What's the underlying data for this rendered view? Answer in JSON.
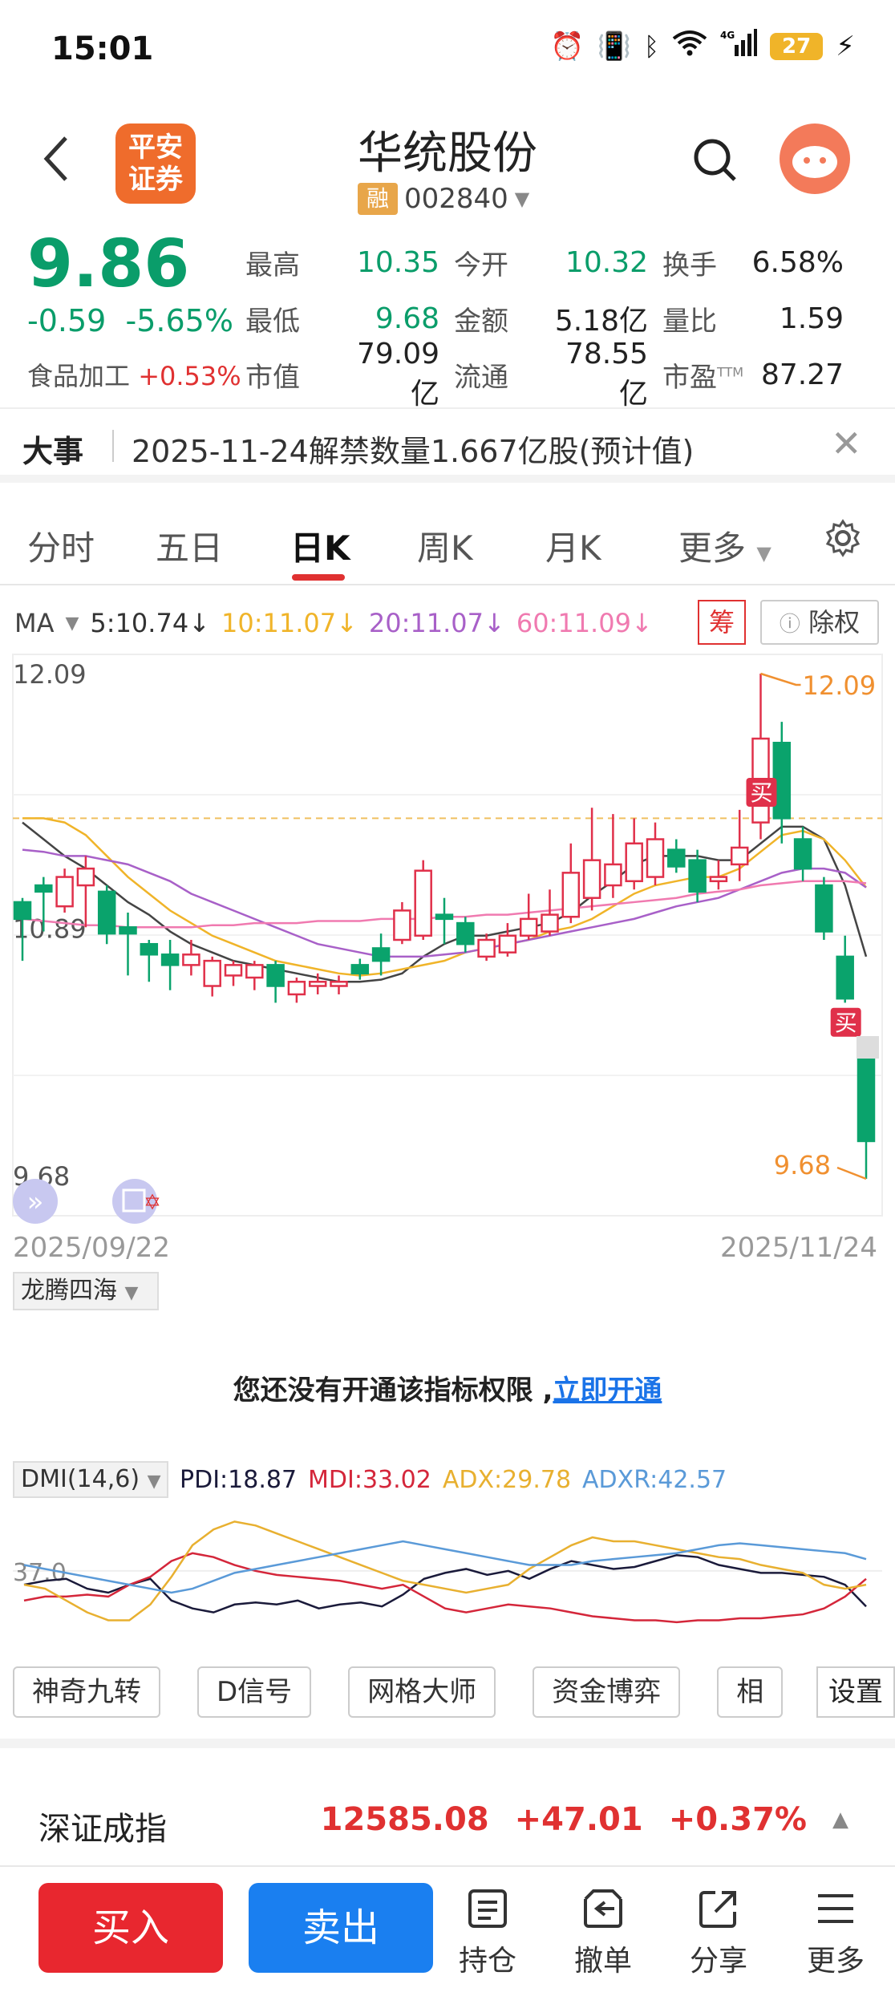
{
  "status_bar": {
    "time": "15:01",
    "battery": "27"
  },
  "header": {
    "broker_logo": "平安证券",
    "stock_name": "华统股份",
    "rong_badge": "融",
    "stock_code": "002840"
  },
  "quote": {
    "price": "9.86",
    "change": "-0.59",
    "change_pct": "-5.65%",
    "industry_label": "食品加工",
    "industry_change": "+0.53%",
    "rows": [
      [
        {
          "label": "最高",
          "value": "10.35"
        },
        {
          "label": "今开",
          "value": "10.32"
        },
        {
          "label": "换手",
          "value": "6.58%"
        }
      ],
      [
        {
          "label": "最低",
          "value": "9.68"
        },
        {
          "label": "金额",
          "value": "5.18亿"
        },
        {
          "label": "量比",
          "value": "1.59"
        }
      ],
      [
        {
          "label": "市值",
          "value": "79.09亿"
        },
        {
          "label": "流通",
          "value": "78.55亿"
        },
        {
          "label": "市盈",
          "value": "87.27"
        }
      ]
    ],
    "pe_suffix": "TTM"
  },
  "event": {
    "title": "大事",
    "text": "2025-11-24解禁数量1.667亿股(预计值)"
  },
  "tabs": [
    "分时",
    "五日",
    "日K",
    "周K",
    "月K",
    "更多"
  ],
  "ma": {
    "label": "MA",
    "items": [
      {
        "text": "5:10.74",
        "color": "#333333"
      },
      {
        "text": "10:11.07",
        "color": "#f0b429"
      },
      {
        "text": "20:11.07",
        "color": "#a860c8"
      },
      {
        "text": "60:11.09",
        "color": "#f07ab0"
      }
    ],
    "chou": "筹",
    "chuquan": "除权"
  },
  "chart_data": {
    "type": "candlestick",
    "y_labels": [
      "12.09",
      "10.89",
      "9.68"
    ],
    "high_label": "12.09",
    "low_label": "9.68",
    "buy_marker": "买",
    "date_start": "2025/09/22",
    "date_end": "2025/11/24",
    "candles": [
      {
        "o": 11.0,
        "c": 10.92,
        "h": 11.02,
        "l": 10.72
      },
      {
        "o": 11.08,
        "c": 11.05,
        "h": 11.12,
        "l": 10.86
      },
      {
        "o": 10.98,
        "c": 11.12,
        "h": 11.16,
        "l": 10.95
      },
      {
        "o": 11.08,
        "c": 11.16,
        "h": 11.22,
        "l": 10.88
      },
      {
        "o": 11.05,
        "c": 10.85,
        "h": 11.08,
        "l": 10.8
      },
      {
        "o": 10.88,
        "c": 10.85,
        "h": 10.95,
        "l": 10.65
      },
      {
        "o": 10.8,
        "c": 10.75,
        "h": 10.82,
        "l": 10.62
      },
      {
        "o": 10.75,
        "c": 10.7,
        "h": 10.82,
        "l": 10.58
      },
      {
        "o": 10.7,
        "c": 10.75,
        "h": 10.82,
        "l": 10.65
      },
      {
        "o": 10.6,
        "c": 10.72,
        "h": 10.74,
        "l": 10.55
      },
      {
        "o": 10.65,
        "c": 10.7,
        "h": 10.72,
        "l": 10.6
      },
      {
        "o": 10.64,
        "c": 10.7,
        "h": 10.72,
        "l": 10.58
      },
      {
        "o": 10.7,
        "c": 10.6,
        "h": 10.72,
        "l": 10.52
      },
      {
        "o": 10.56,
        "c": 10.62,
        "h": 10.64,
        "l": 10.52
      },
      {
        "o": 10.6,
        "c": 10.62,
        "h": 10.66,
        "l": 10.56
      },
      {
        "o": 10.6,
        "c": 10.62,
        "h": 10.65,
        "l": 10.56
      },
      {
        "o": 10.7,
        "c": 10.66,
        "h": 10.73,
        "l": 10.63
      },
      {
        "o": 10.78,
        "c": 10.72,
        "h": 10.85,
        "l": 10.65
      },
      {
        "o": 10.82,
        "c": 10.96,
        "h": 11.0,
        "l": 10.8
      },
      {
        "o": 10.84,
        "c": 11.15,
        "h": 11.2,
        "l": 10.82
      },
      {
        "o": 10.94,
        "c": 10.92,
        "h": 11.02,
        "l": 10.8
      },
      {
        "o": 10.9,
        "c": 10.8,
        "h": 10.93,
        "l": 10.76
      },
      {
        "o": 10.74,
        "c": 10.82,
        "h": 10.85,
        "l": 10.72
      },
      {
        "o": 10.76,
        "c": 10.84,
        "h": 10.9,
        "l": 10.74
      },
      {
        "o": 10.84,
        "c": 10.92,
        "h": 11.04,
        "l": 10.82
      },
      {
        "o": 10.86,
        "c": 10.94,
        "h": 11.06,
        "l": 10.84
      },
      {
        "o": 10.93,
        "c": 11.14,
        "h": 11.28,
        "l": 10.9
      },
      {
        "o": 11.02,
        "c": 11.2,
        "h": 11.45,
        "l": 10.96
      },
      {
        "o": 11.08,
        "c": 11.18,
        "h": 11.42,
        "l": 11.02
      },
      {
        "o": 11.1,
        "c": 11.28,
        "h": 11.4,
        "l": 11.06
      },
      {
        "o": 11.12,
        "c": 11.3,
        "h": 11.38,
        "l": 11.08
      },
      {
        "o": 11.25,
        "c": 11.17,
        "h": 11.3,
        "l": 11.14
      },
      {
        "o": 11.2,
        "c": 11.05,
        "h": 11.25,
        "l": 11.0
      },
      {
        "o": 11.1,
        "c": 11.12,
        "h": 11.2,
        "l": 11.06
      },
      {
        "o": 11.18,
        "c": 11.26,
        "h": 11.44,
        "l": 11.1
      },
      {
        "o": 11.38,
        "c": 11.78,
        "h": 12.09,
        "l": 11.3
      },
      {
        "o": 11.76,
        "c": 11.4,
        "h": 11.86,
        "l": 11.28
      },
      {
        "o": 11.3,
        "c": 11.16,
        "h": 11.36,
        "l": 11.1
      },
      {
        "o": 11.08,
        "c": 10.86,
        "h": 11.12,
        "l": 10.82
      },
      {
        "o": 10.74,
        "c": 10.54,
        "h": 10.84,
        "l": 10.52
      },
      {
        "o": 10.35,
        "c": 9.86,
        "h": 10.35,
        "l": 9.68
      }
    ],
    "ma_lines": {
      "ma5": [
        11.38,
        11.3,
        11.22,
        11.16,
        11.08,
        11.0,
        10.94,
        10.86,
        10.8,
        10.76,
        10.72,
        10.7,
        10.68,
        10.66,
        10.64,
        10.62,
        10.62,
        10.63,
        10.66,
        10.74,
        10.8,
        10.84,
        10.84,
        10.86,
        10.88,
        10.9,
        10.95,
        11.03,
        11.1,
        11.18,
        11.22,
        11.22,
        11.22,
        11.2,
        11.2,
        11.28,
        11.36,
        11.36,
        11.3,
        11.08,
        10.74
      ],
      "ma10": [
        11.4,
        11.4,
        11.38,
        11.32,
        11.22,
        11.12,
        11.04,
        10.96,
        10.9,
        10.84,
        10.8,
        10.76,
        10.72,
        10.7,
        10.68,
        10.66,
        10.65,
        10.66,
        10.68,
        10.7,
        10.72,
        10.76,
        10.78,
        10.8,
        10.82,
        10.86,
        10.88,
        10.92,
        10.98,
        11.04,
        11.08,
        11.1,
        11.12,
        11.12,
        11.16,
        11.24,
        11.32,
        11.34,
        11.3,
        11.2,
        11.07
      ],
      "ma20": [
        11.25,
        11.24,
        11.22,
        11.22,
        11.2,
        11.18,
        11.14,
        11.1,
        11.04,
        11.0,
        10.96,
        10.92,
        10.88,
        10.84,
        10.8,
        10.78,
        10.76,
        10.74,
        10.74,
        10.74,
        10.75,
        10.76,
        10.78,
        10.8,
        10.82,
        10.84,
        10.86,
        10.88,
        10.9,
        10.92,
        10.95,
        10.98,
        11.0,
        11.02,
        11.06,
        11.1,
        11.14,
        11.16,
        11.16,
        11.14,
        11.07
      ],
      "ma60": [
        10.92,
        10.91,
        10.9,
        10.89,
        10.89,
        10.88,
        10.88,
        10.88,
        10.88,
        10.89,
        10.89,
        10.9,
        10.9,
        10.9,
        10.91,
        10.91,
        10.91,
        10.92,
        10.92,
        10.92,
        10.93,
        10.93,
        10.94,
        10.94,
        10.95,
        10.96,
        10.97,
        10.98,
        10.99,
        11.0,
        11.01,
        11.02,
        11.04,
        11.05,
        11.06,
        11.08,
        11.09,
        11.1,
        11.1,
        11.1,
        11.09
      ]
    },
    "reference_line": 11.4,
    "buy_markers_index": [
      35,
      39
    ]
  },
  "indicator_selector": "龙腾四海",
  "notice": {
    "text": "您还没有开通该指标权限 ,",
    "link": "立即开通"
  },
  "dmi": {
    "selector": "DMI(14,6)",
    "items": [
      {
        "text": "PDI:18.87",
        "color": "#1a1a3a"
      },
      {
        "text": "MDI:33.02",
        "color": "#d4263a"
      },
      {
        "text": "ADX:29.78",
        "color": "#e8b030"
      },
      {
        "text": "ADXR:42.57",
        "color": "#5a9ad8"
      }
    ],
    "axis_label": "37.0",
    "series": {
      "pdi": [
        30,
        32,
        33,
        28,
        26,
        30,
        33,
        22,
        18,
        16,
        20,
        21,
        20,
        22,
        18,
        20,
        21,
        19,
        25,
        33,
        36,
        38,
        35,
        37,
        33,
        38,
        42,
        40,
        38,
        39,
        42,
        45,
        44,
        40,
        38,
        36,
        36,
        35,
        34,
        30,
        19
      ],
      "mdi": [
        22,
        24,
        24,
        25,
        24,
        30,
        34,
        42,
        46,
        44,
        40,
        37,
        35,
        34,
        33,
        32,
        30,
        28,
        30,
        24,
        18,
        16,
        18,
        20,
        19,
        18,
        16,
        14,
        13,
        12,
        12,
        11,
        12,
        12,
        13,
        13,
        14,
        15,
        18,
        24,
        33
      ],
      "adx": [
        30,
        28,
        22,
        16,
        12,
        12,
        20,
        34,
        50,
        58,
        62,
        60,
        56,
        52,
        48,
        44,
        40,
        36,
        32,
        30,
        28,
        26,
        28,
        30,
        38,
        44,
        50,
        54,
        52,
        52,
        50,
        48,
        46,
        44,
        43,
        40,
        38,
        36,
        30,
        28,
        30
      ],
      "adxr": [
        40,
        38,
        36,
        34,
        32,
        30,
        28,
        26,
        28,
        32,
        36,
        38,
        40,
        42,
        44,
        46,
        48,
        50,
        52,
        50,
        48,
        46,
        44,
        42,
        40,
        40,
        40,
        42,
        43,
        44,
        45,
        46,
        48,
        50,
        51,
        50,
        49,
        48,
        47,
        46,
        43
      ]
    }
  },
  "tool_buttons": [
    "神奇九转",
    "D信号",
    "网格大师",
    "资金博弈",
    "相"
  ],
  "settings_label": "设置",
  "index": {
    "name": "深证成指",
    "value": "12585.08",
    "change": "+47.01",
    "change_pct": "+0.37%"
  },
  "bottom_bar": {
    "buy": "买入",
    "sell": "卖出",
    "nav": [
      "持仓",
      "撤单",
      "分享",
      "更多"
    ]
  }
}
